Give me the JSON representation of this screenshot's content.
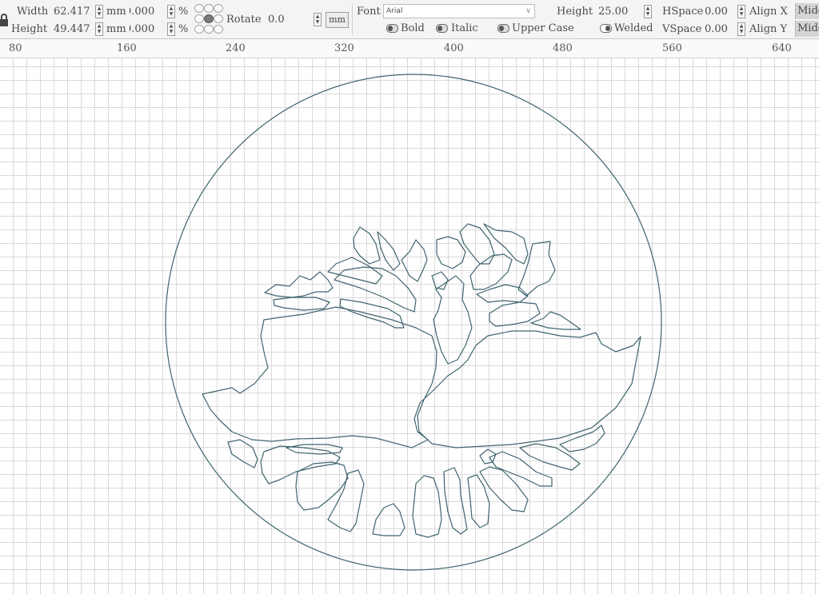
{
  "toolbar": {
    "width": {
      "label": "Width",
      "value": "62.417",
      "unit": "mm"
    },
    "height": {
      "label": "Height",
      "value": "49.447",
      "unit": "mm"
    },
    "scale_x": {
      "value": "0.000",
      "unit": "%"
    },
    "scale_y": {
      "value": "0.000",
      "unit": "%"
    },
    "rotate": {
      "label": "Rotate",
      "value": "0.0"
    },
    "unit_button": "mm",
    "font": {
      "label": "Font",
      "value": "Arial"
    },
    "bold_label": "Bold",
    "italic_label": "Italic",
    "uppercase_label": "Upper Case",
    "welded_label": "Welded",
    "text_height": {
      "label": "Height",
      "value": "25.00"
    },
    "hspace": {
      "label": "HSpace",
      "value": "0.00"
    },
    "vspace": {
      "label": "VSpace",
      "value": "0.00"
    },
    "align_x": {
      "label": "Align X",
      "value": "Middle"
    },
    "align_y": {
      "label": "Align Y",
      "value": "Middle"
    }
  },
  "ruler": {
    "labels": [
      "80",
      "160",
      "240",
      "320",
      "400",
      "480",
      "560",
      "640"
    ]
  },
  "canvas": {
    "grid_color": "#d9d9d9",
    "path_color": "#3f6470"
  },
  "icons": {
    "lock": "lock-icon",
    "toggle": "toggle-icon",
    "anchor": "anchor-point-icon"
  }
}
